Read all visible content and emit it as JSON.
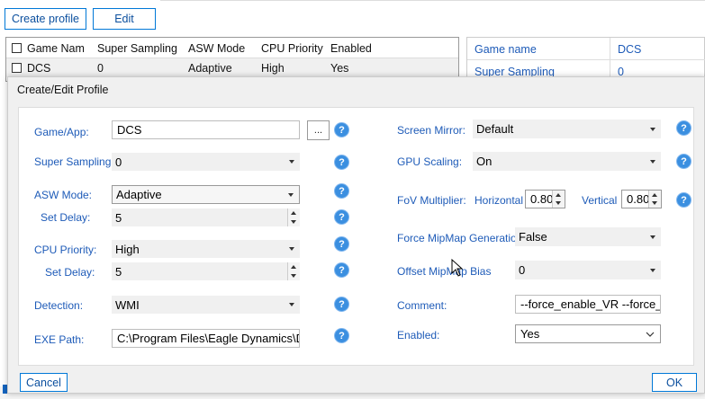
{
  "toolbar": {
    "create_label": "Create profile",
    "edit_label": "Edit"
  },
  "grid": {
    "headers": [
      "Game Nam",
      "Super Sampling",
      "ASW Mode",
      "CPU Priority",
      "Enabled"
    ],
    "row": {
      "game": "DCS",
      "ss": "0",
      "asw": "Adaptive",
      "cpu": "High",
      "enabled": "Yes"
    }
  },
  "details": {
    "header_key": "Game name",
    "header_val": "DCS",
    "row1_key": "Super Sampling",
    "row1_val": "0"
  },
  "dialog": {
    "title": "Create/Edit Profile",
    "game_label": "Game/App:",
    "game_value": "DCS",
    "browse_label": "...",
    "ss_label": "Super Sampling:",
    "ss_value": "0",
    "asw_label": "ASW Mode:",
    "asw_value": "Adaptive",
    "asw_delay_label": "Set Delay:",
    "asw_delay_value": "5",
    "cpu_label": "CPU Priority:",
    "cpu_value": "High",
    "cpu_delay_label": "Set Delay:",
    "cpu_delay_value": "5",
    "detect_label": "Detection:",
    "detect_value": "WMI",
    "exe_label": "EXE Path:",
    "exe_value": "C:\\Program Files\\Eagle Dynamics\\DC",
    "mirror_label": "Screen Mirror:",
    "mirror_value": "Default",
    "gpu_label": "GPU Scaling:",
    "gpu_value": "On",
    "fov_label": "FoV Multiplier:",
    "fov_h_label": "Horizontal",
    "fov_h_value": "0.80",
    "fov_v_label": "Vertical",
    "fov_v_value": "0.80",
    "mip_label": "Force MipMap Generation",
    "mip_value": "False",
    "offset_label": "Offset MipMap Bias",
    "offset_value": "0",
    "comment_label": "Comment:",
    "comment_value": "--force_enable_VR --force_C",
    "enabled_label": "Enabled:",
    "enabled_value": "Yes",
    "help_glyph": "?",
    "cancel_label": "Cancel",
    "ok_label": "OK"
  },
  "colors": {
    "accent": "#0078d7",
    "label_blue": "#1e5bb8",
    "help_blue": "#3b8fe0"
  }
}
